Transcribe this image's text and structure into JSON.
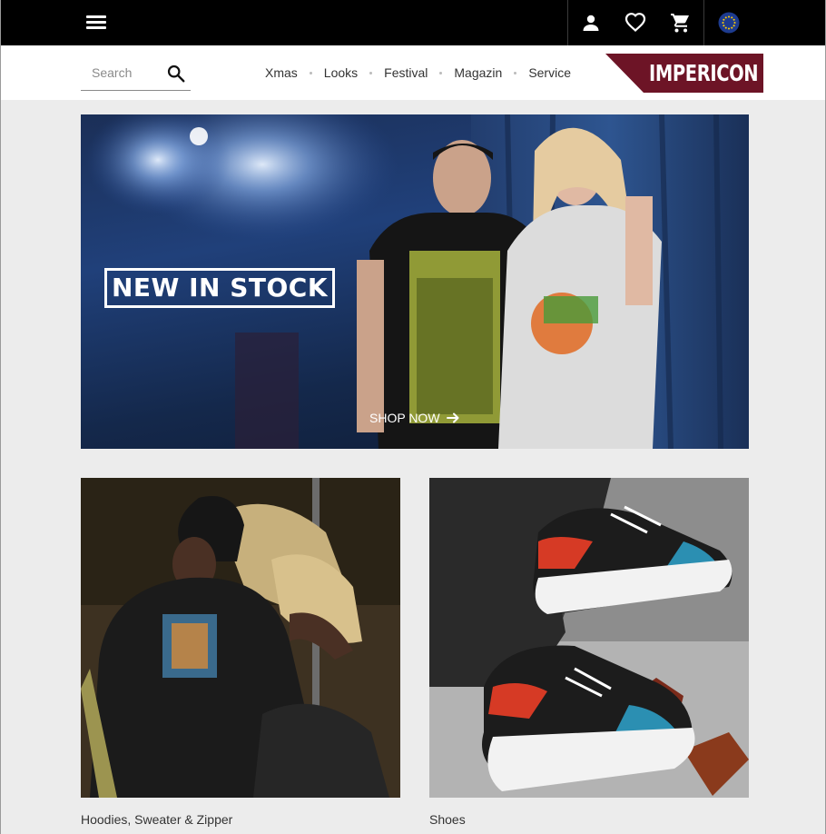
{
  "header": {
    "menu_icon": "hamburger-menu-icon",
    "icons": [
      "account-icon",
      "wishlist-heart-icon",
      "cart-icon",
      "eu-flag-icon"
    ]
  },
  "nav": {
    "search_placeholder": "Search",
    "search_icon": "search-icon",
    "links": [
      "Xmas",
      "Looks",
      "Festival",
      "Magazin",
      "Service"
    ],
    "logo_text": "IMPERICON",
    "logo_color": "#6d1426"
  },
  "hero": {
    "badge": "NEW IN STOCK",
    "cta": "SHOP NOW",
    "cta_icon": "arrow-right-icon"
  },
  "categories": [
    {
      "label": "Hoodies, Sweater & Zipper"
    },
    {
      "label": "Shoes"
    }
  ],
  "colors": {
    "topbar": "#000000",
    "background": "#ececec",
    "text": "#333333",
    "eu_blue": "#003399",
    "eu_gold": "#ffcc00"
  }
}
